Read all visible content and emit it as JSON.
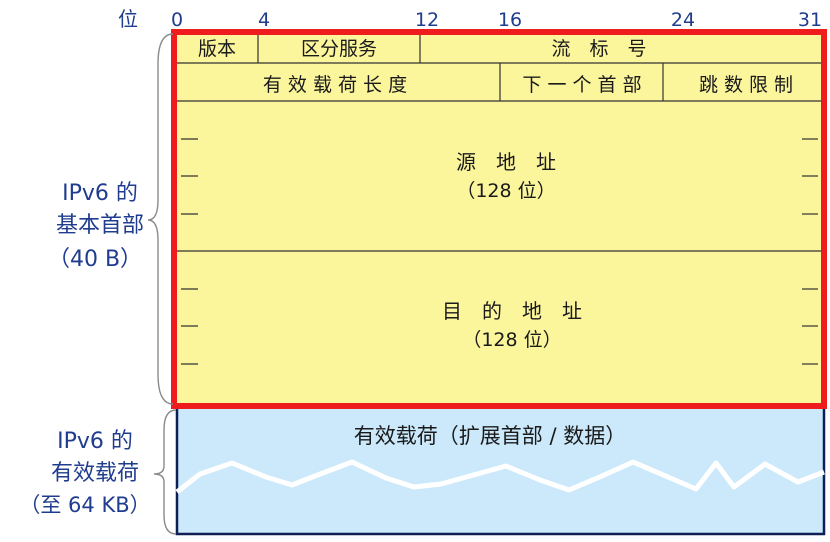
{
  "bit_scale": {
    "label": "位",
    "ticks": [
      "0",
      "4",
      "12",
      "16",
      "24",
      "31"
    ]
  },
  "header": {
    "row1": {
      "version": "版本",
      "traffic_class": "区分服务",
      "flow_label": "流　标　号"
    },
    "row2": {
      "payload_length": "有 效 载 荷 长 度",
      "next_header": "下 一 个 首 部",
      "hop_limit": "跳 数 限 制"
    },
    "source": {
      "title": "源　地　址",
      "size": "（128 位）"
    },
    "destination": {
      "title": "目　的　地　址",
      "size": "（128 位）"
    }
  },
  "payload": {
    "title": "有效载荷（扩展首部 / 数据）"
  },
  "side_labels": {
    "base_header": [
      "IPv6 的",
      "基本首部",
      "（40 B）"
    ],
    "payload": [
      "IPv6 的",
      "有效载荷",
      "（至 64 KB）"
    ]
  },
  "colors": {
    "header_fill": "#fbf59c",
    "highlight_border": "#ee1c1c",
    "payload_fill": "#cbe9fb",
    "label_text": "#1f3c8f",
    "field_text": "#1a1a1a"
  }
}
